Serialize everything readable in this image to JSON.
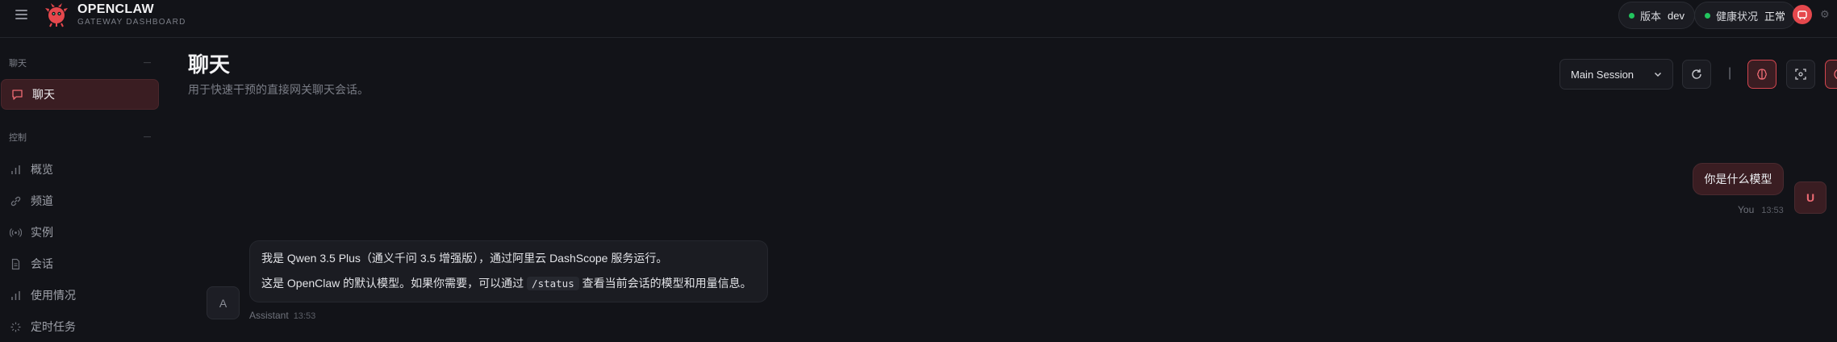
{
  "brand": {
    "title": "OPENCLAW",
    "subtitle": "GATEWAY DASHBOARD"
  },
  "header": {
    "version_label": "版本",
    "version_value": "dev",
    "health_label": "健康状况",
    "health_value": "正常",
    "status_color": "#22c55e",
    "accent": "#e5484d"
  },
  "sidebar": {
    "sections": [
      {
        "label": "聊天",
        "items": [
          {
            "label": "聊天",
            "icon": "message-icon",
            "active": true
          }
        ]
      },
      {
        "label": "控制",
        "items": [
          {
            "label": "概览",
            "icon": "bar-chart-icon"
          },
          {
            "label": "频道",
            "icon": "link-icon"
          },
          {
            "label": "实例",
            "icon": "broadcast-icon"
          },
          {
            "label": "会话",
            "icon": "document-icon"
          },
          {
            "label": "使用情况",
            "icon": "bar-chart-icon"
          },
          {
            "label": "定时任务",
            "icon": "loader-icon"
          }
        ]
      }
    ]
  },
  "page": {
    "title": "聊天",
    "subtitle": "用于快速干预的直接网关聊天会话。"
  },
  "toolbar": {
    "session_value": "Main Session"
  },
  "messages": {
    "user": {
      "text": "你是什么模型",
      "author": "You",
      "time": "13:53",
      "avatar": "U"
    },
    "assistant": {
      "line1": "我是 Qwen 3.5 Plus（通义千问 3.5 增强版），通过阿里云 DashScope 服务运行。",
      "line2_before": "这是 OpenClaw 的默认模型。如果你需要，可以通过",
      "line2_code": "/status",
      "line2_after": "查看当前会话的模型和用量信息。",
      "author": "Assistant",
      "time": "13:53",
      "avatar": "A"
    }
  }
}
